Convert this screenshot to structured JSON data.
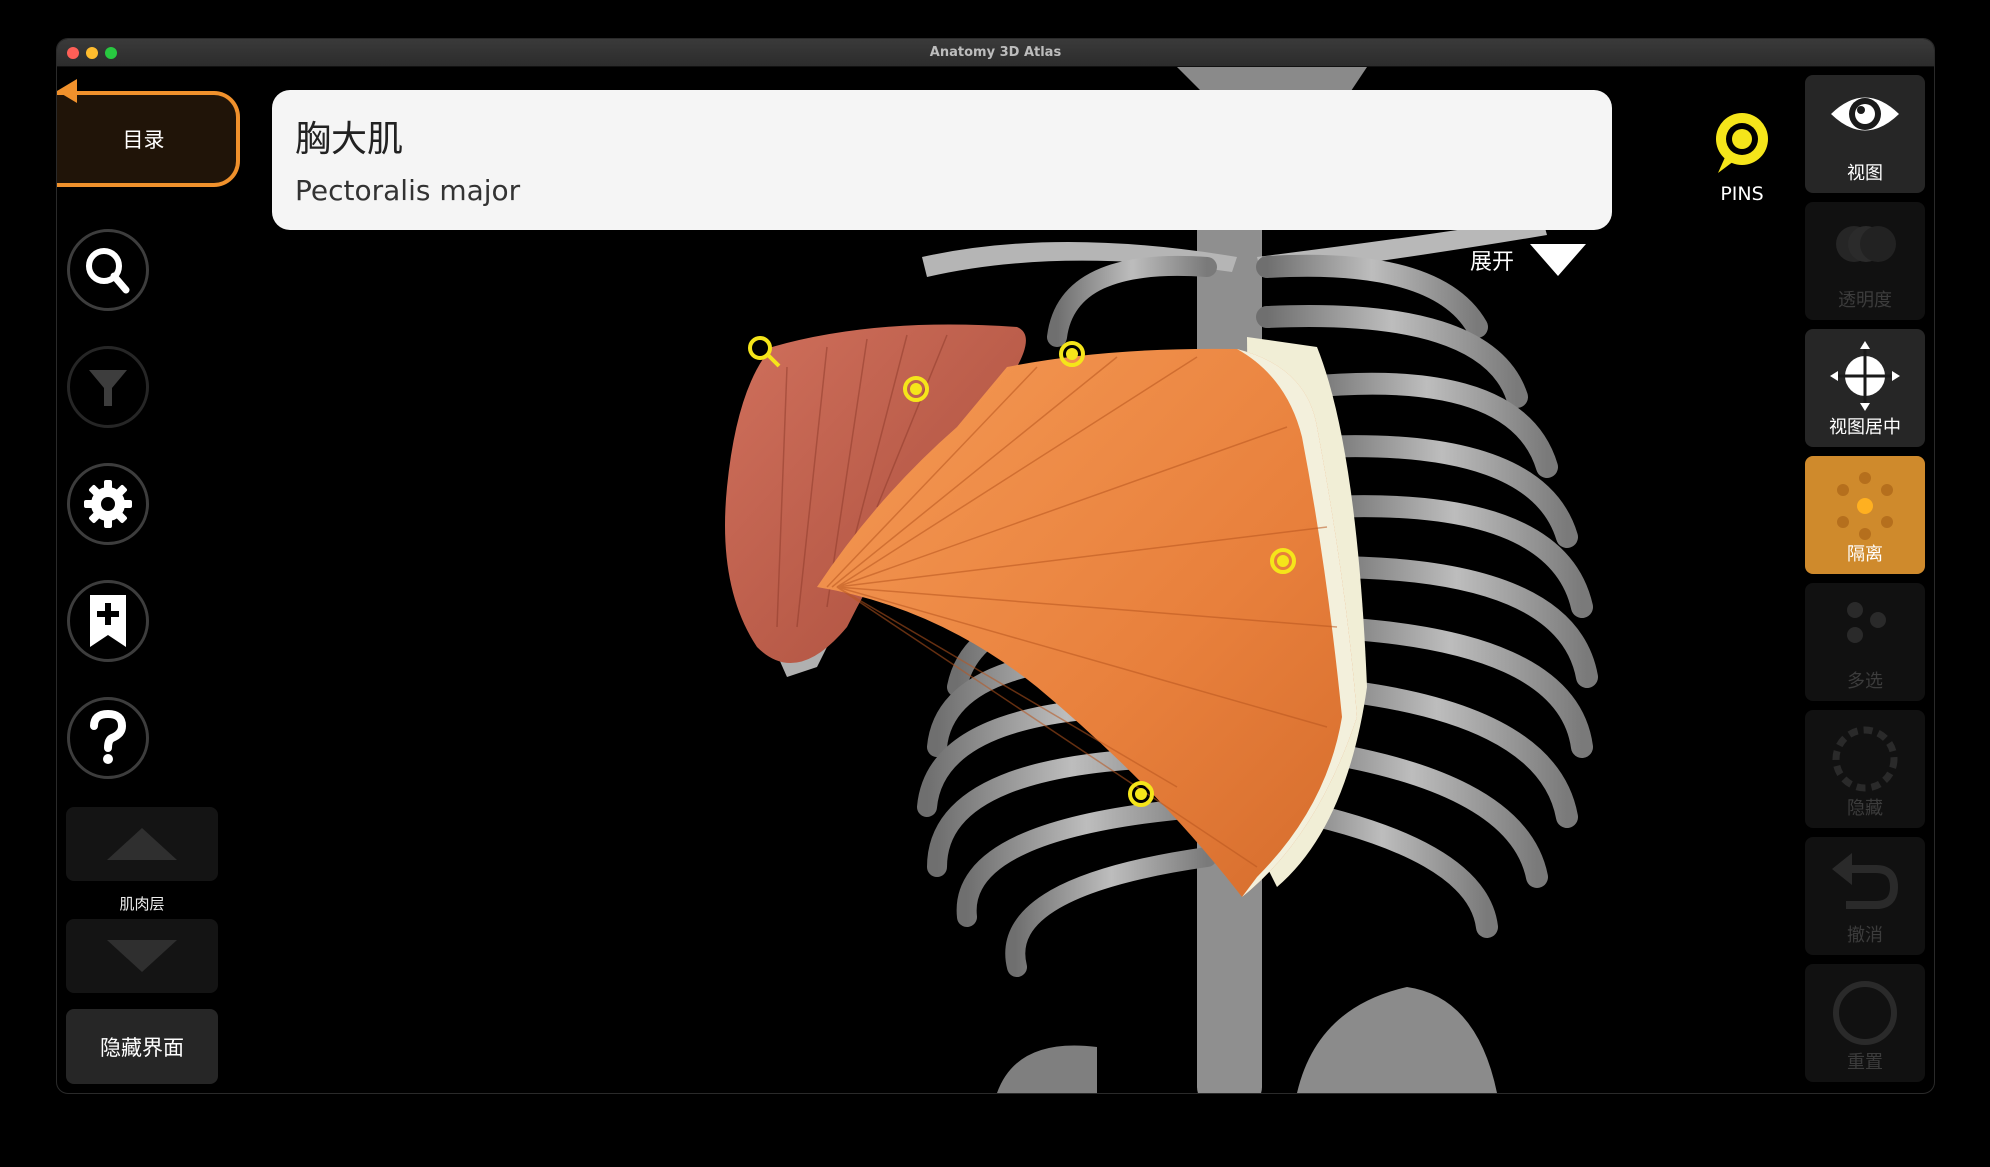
{
  "window": {
    "title": "Anatomy 3D Atlas"
  },
  "left_toolbar": {
    "menu_label": "目录",
    "layer_label": "肌肉层",
    "hide_ui_label": "隐藏界面",
    "icons": [
      "search-icon",
      "filter-icon",
      "settings-icon",
      "bookmark-add-icon",
      "help-icon",
      "layer-up-icon",
      "layer-down-icon"
    ]
  },
  "info_panel": {
    "name_cn": "胸大肌",
    "name_en": "Pectoralis major",
    "expand_label": "展开"
  },
  "pins": {
    "label": "PINS"
  },
  "right_toolbar": {
    "items": [
      {
        "label": "视图",
        "state": "enabled",
        "icon": "eye-icon"
      },
      {
        "label": "透明度",
        "state": "disabled",
        "icon": "transparency-icon"
      },
      {
        "label": "视图居中",
        "state": "enabled",
        "icon": "center-view-icon"
      },
      {
        "label": "隔离",
        "state": "active",
        "icon": "isolate-icon"
      },
      {
        "label": "多选",
        "state": "disabled",
        "icon": "multi-select-icon"
      },
      {
        "label": "隐藏",
        "state": "disabled",
        "icon": "hide-icon"
      },
      {
        "label": "撤消",
        "state": "disabled",
        "icon": "undo-icon"
      },
      {
        "label": "重置",
        "state": "disabled",
        "icon": "reset-icon"
      }
    ]
  },
  "colors": {
    "accent_orange": "#f0912c",
    "isolate_active": "#cf8a2c",
    "pin_yellow": "#f5e51a"
  }
}
